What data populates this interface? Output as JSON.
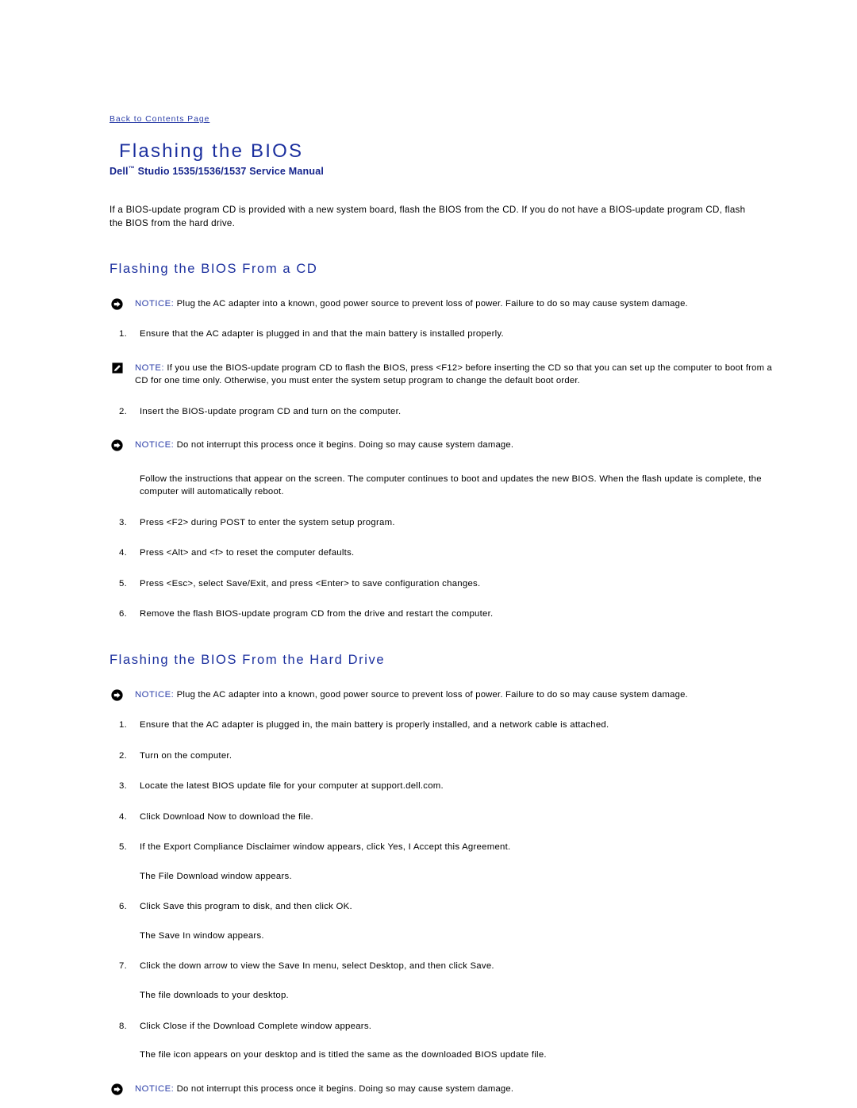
{
  "backlink": {
    "label": "Back to Contents Page"
  },
  "header": {
    "title": "Flashing the BIOS",
    "subtitle_prefix": "Dell",
    "subtitle_tm": "™",
    "subtitle_rest": " Studio 1535/1536/1537 Service Manual"
  },
  "colors": {
    "title_blue": "#1b2f9e",
    "link_blue": "#2b3ea8",
    "subtitle_blue": "#14238c",
    "body_black": "#000000",
    "page_background": "#ffffff"
  },
  "intro": "If a BIOS-update program CD is provided with a new system board, flash the BIOS from the CD. If you do not have a BIOS-update program CD, flash the BIOS from the hard drive.",
  "sections": [
    {
      "heading": "Flashing the BIOS From a CD",
      "notice_top": {
        "icon": "notice-arrow-icon",
        "label": "NOTICE:",
        "text": " Plug the AC adapter into a known, good power source to prevent loss of power. Failure to do so may cause system damage."
      },
      "step1": {
        "num": "1.",
        "text": "Ensure that the AC adapter is plugged in and that the main battery is installed properly."
      },
      "note": {
        "icon": "note-pencil-icon",
        "label": "NOTE:",
        "text": " If you use the BIOS-update program CD to flash the BIOS, press <F12> before inserting the CD so that you can set up the computer to boot from a CD for one time only. Otherwise, you must enter the system setup program to change the default boot order."
      },
      "step2": {
        "num": "2.",
        "text": "Insert the BIOS-update program CD and turn on the computer."
      },
      "notice_mid": {
        "icon": "notice-arrow-icon",
        "label": "NOTICE:",
        "text": " Do not interrupt this process once it begins. Doing so may cause system damage."
      },
      "follow_para": "Follow the instructions that appear on the screen. The computer continues to boot and updates the new BIOS. When the flash update is complete, the computer will automatically reboot.",
      "steps_tail": [
        {
          "num": "3.",
          "text": "Press <F2> during POST to enter the system setup program."
        },
        {
          "num": "4.",
          "text": "Press <Alt> and <f> to reset the computer defaults."
        },
        {
          "num": "5.",
          "text": "Press <Esc>, select Save/Exit, and press <Enter> to save configuration changes."
        },
        {
          "num": "6.",
          "text": "Remove the flash BIOS-update program CD from the drive and restart the computer."
        }
      ]
    },
    {
      "heading": "Flashing the BIOS From the Hard Drive",
      "notice_top": {
        "icon": "notice-arrow-icon",
        "label": "NOTICE:",
        "text": " Plug the AC adapter into a known, good power source to prevent loss of power. Failure to do so may cause system damage."
      },
      "steps": [
        {
          "num": "1.",
          "text": "Ensure that the AC adapter is plugged in, the main battery is properly installed, and a network cable is attached.",
          "followup": ""
        },
        {
          "num": "2.",
          "text": "Turn on the computer.",
          "followup": ""
        },
        {
          "num": "3.",
          "text": "Locate the latest BIOS update file for your computer at support.dell.com.",
          "followup": ""
        },
        {
          "num": "4.",
          "text": "Click Download Now to download the file.",
          "followup": ""
        },
        {
          "num": "5.",
          "text": "If the Export Compliance Disclaimer window appears, click Yes, I Accept this Agreement.",
          "followup": "The File Download window appears."
        },
        {
          "num": "6.",
          "text": "Click Save this program to disk, and then click OK.",
          "followup": "The Save In window appears."
        },
        {
          "num": "7.",
          "text": "Click the down arrow to view the Save In menu, select Desktop, and then click Save.",
          "followup": "The file downloads to your desktop."
        },
        {
          "num": "8.",
          "text": "Click Close if the Download Complete window appears.",
          "followup": "The file icon appears on your desktop and is titled the same as the downloaded BIOS update file."
        }
      ],
      "notice_bottom": {
        "icon": "notice-arrow-icon",
        "label": "NOTICE:",
        "text": " Do not interrupt this process once it begins. Doing so may cause system damage."
      }
    }
  ]
}
